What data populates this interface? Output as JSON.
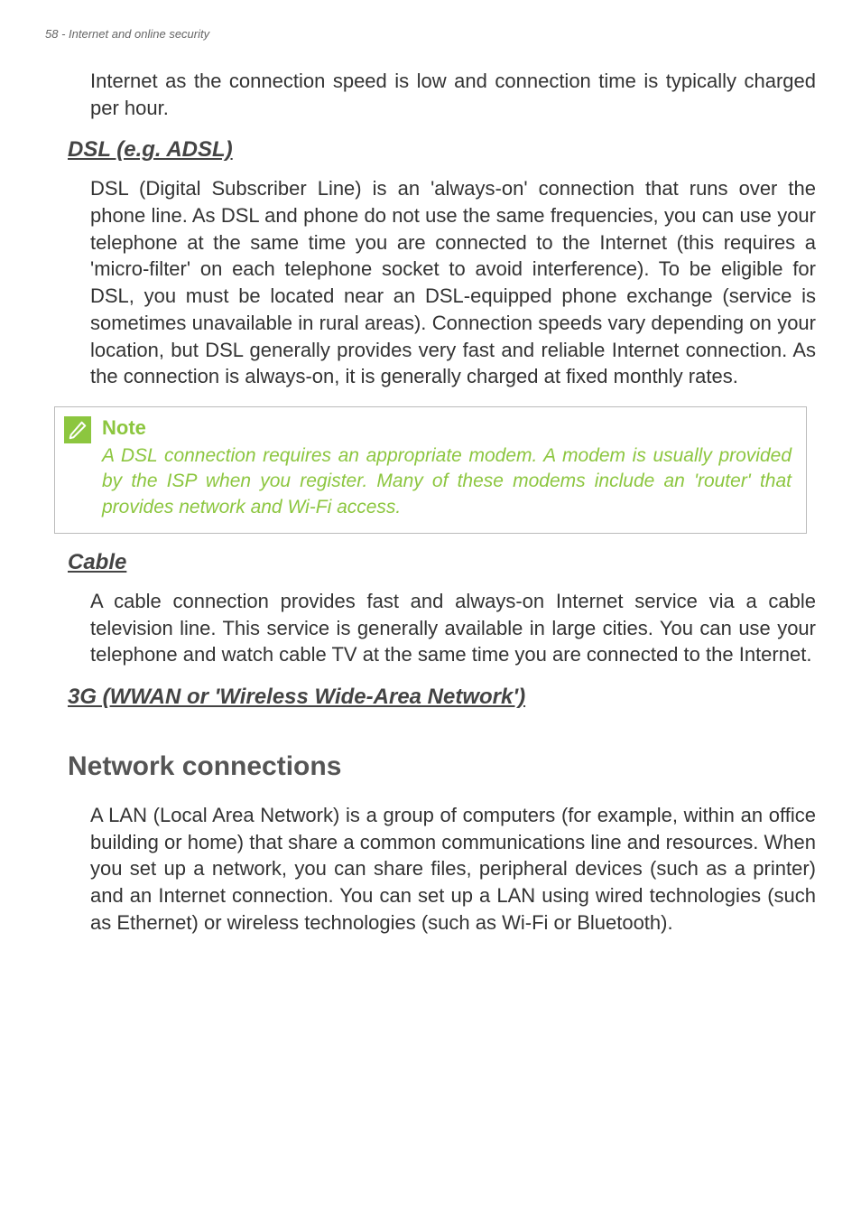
{
  "header": {
    "text": "58 - Internet and online security"
  },
  "intro": {
    "continuation": "Internet as the connection speed is low and connection time is typically charged per hour."
  },
  "dsl": {
    "heading": "DSL (e.g. ADSL)",
    "body": "DSL (Digital Subscriber Line) is an 'always-on' connection that runs over the phone line. As DSL and phone do not use the same frequencies, you can use your telephone at the same time you are connected to the Internet (this requires a 'micro-filter' on each telephone socket to avoid interference). To be eligible for DSL, you must be located near an DSL-equipped phone exchange (service is sometimes unavailable in rural areas). Connection speeds vary depending on your location, but DSL generally provides very fast and reliable Internet connection. As the connection is always-on, it is generally charged at fixed monthly rates."
  },
  "note": {
    "title": "Note",
    "body": "A DSL connection requires an appropriate modem. A modem is usually provided by the ISP when you register. Many of these modems include an 'router' that provides network and Wi-Fi access."
  },
  "cable": {
    "heading": "Cable",
    "body": "A cable connection provides fast and always-on Internet service via a cable television line. This service is generally available in large cities. You can use your telephone and watch cable TV at the same time you are connected to the Internet."
  },
  "wwan": {
    "heading": "3G (WWAN or 'Wireless Wide-Area Network')"
  },
  "network": {
    "heading": "Network connections",
    "body": "A LAN (Local Area Network) is a group of computers (for example, within an office building or home) that share a common communications line and resources. When you set up a network, you can share files, peripheral devices (such as a printer) and an Internet connection. You can set up a LAN using wired technologies (such as Ethernet) or wireless technologies (such as Wi-Fi or Bluetooth)."
  }
}
